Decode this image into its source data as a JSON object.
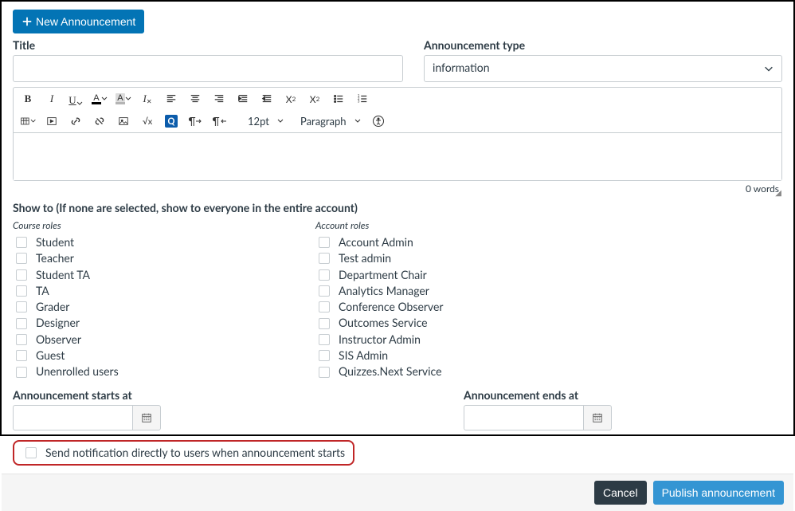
{
  "header": {
    "new_announcement_label": "New Announcement"
  },
  "form": {
    "title_label": "Title",
    "title_value": "",
    "type_label": "Announcement type",
    "type_value": "information"
  },
  "editor": {
    "font_size": "12pt",
    "block_format": "Paragraph",
    "content": "",
    "word_count": "0 words",
    "toolbar_icons": {
      "bold": "bold-icon",
      "italic": "italic-icon",
      "underline": "underline-icon",
      "font_color": "font-color-icon",
      "bg_color": "bg-color-icon",
      "clear_format": "clear-format-icon",
      "align_left": "align-left-icon",
      "align_center": "align-center-icon",
      "align_right": "align-right-icon",
      "indent": "indent-icon",
      "outdent": "outdent-icon",
      "superscript": "superscript-icon",
      "subscript": "subscript-icon",
      "bullet_list": "bullet-list-icon",
      "number_list": "number-list-icon",
      "table": "table-icon",
      "embed": "embed-icon",
      "link": "link-icon",
      "unlink": "unlink-icon",
      "image": "image-icon",
      "equation": "equation-icon",
      "q": "q-icon",
      "ltr": "ltr-icon",
      "rtl": "rtl-icon",
      "a11y": "accessibility-icon"
    }
  },
  "show_to": {
    "heading": "Show to (If none are selected, show to everyone in the entire account)",
    "course_roles_label": "Course roles",
    "account_roles_label": "Account roles",
    "course_roles": [
      "Student",
      "Teacher",
      "Student TA",
      "TA",
      "Grader",
      "Designer",
      "Observer",
      "Guest",
      "Unenrolled users"
    ],
    "account_roles": [
      "Account Admin",
      "Test admin",
      "Department Chair",
      "Analytics Manager",
      "Conference Observer",
      "Outcomes Service",
      "Instructor Admin",
      "SIS Admin",
      "Quizzes.Next Service"
    ]
  },
  "dates": {
    "starts_label": "Announcement starts at",
    "ends_label": "Announcement ends at",
    "starts_value": "",
    "ends_value": ""
  },
  "notify": {
    "label": "Send notification directly to users when announcement starts",
    "checked": false
  },
  "footer": {
    "cancel_label": "Cancel",
    "publish_label": "Publish announcement"
  }
}
